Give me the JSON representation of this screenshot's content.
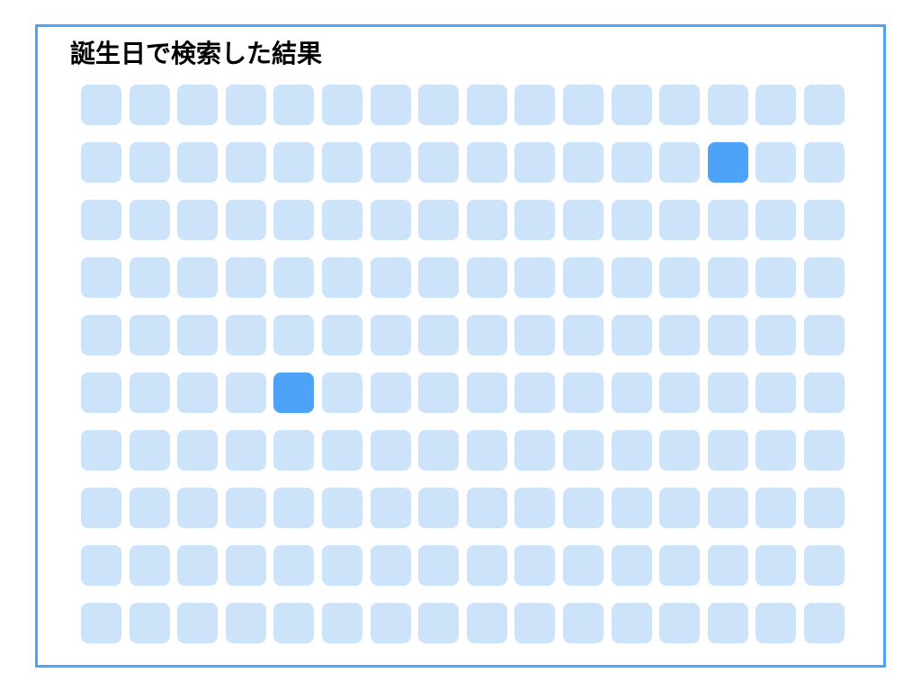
{
  "title": "誕生日で検索した結果",
  "grid": {
    "rows": 10,
    "columns": 16,
    "highlighted": [
      {
        "row": 2,
        "column": 14
      },
      {
        "row": 6,
        "column": 5
      }
    ]
  },
  "colors": {
    "frame_border": "#4da3f7",
    "cell_default": "#cce3fa",
    "cell_highlighted": "#4da3f7",
    "title_text": "#000000"
  }
}
